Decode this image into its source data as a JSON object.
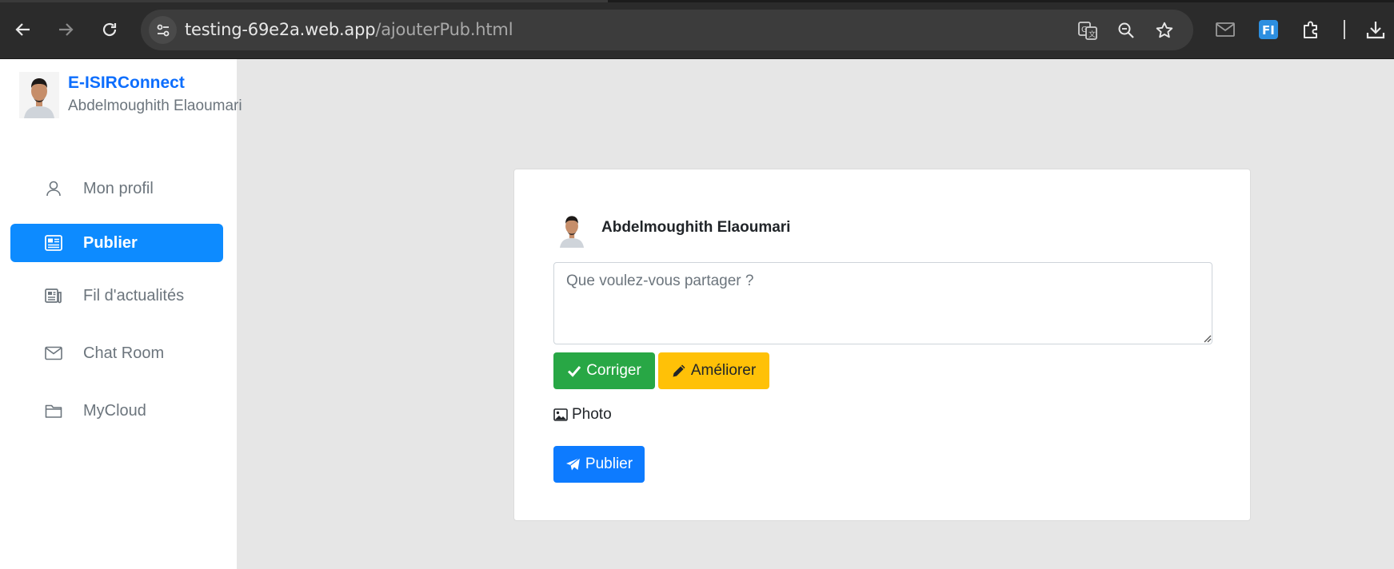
{
  "browser": {
    "url_host": "testing-69e2a.web.app",
    "url_path": "/ajouterPub.html",
    "icons": [
      "back-arrow-icon",
      "forward-arrow-icon",
      "reload-icon",
      "site-settings-icon",
      "translate-icon",
      "zoom-icon",
      "bookmark-star-icon",
      "mail-extension-icon",
      "fi-extension-icon",
      "extensions-puzzle-icon",
      "download-icon"
    ]
  },
  "sidebar": {
    "brand_title": "E-ISIRConnect",
    "user_name": "Abdelmoughith Elaoumari",
    "items": [
      {
        "label": "Mon profil",
        "icon": "user-icon"
      },
      {
        "label": "Publier",
        "icon": "newspaper-icon",
        "active": true
      },
      {
        "label": "Fil d'actualités",
        "icon": "news-feed-icon"
      },
      {
        "label": "Chat Room",
        "icon": "envelope-icon"
      },
      {
        "label": "MyCloud",
        "icon": "folder-icon"
      }
    ]
  },
  "post": {
    "author": "Abdelmoughith Elaoumari",
    "placeholder": "Que voulez-vous partager ?",
    "value": "",
    "correct_label": "Corriger",
    "improve_label": "Améliorer",
    "photo_label": "Photo",
    "publish_label": "Publier"
  },
  "colors": {
    "brand": "#0d6efd",
    "active_nav": "#0d8bff",
    "correct": "#28a745",
    "improve": "#ffc107",
    "publish": "#0d7bff"
  }
}
